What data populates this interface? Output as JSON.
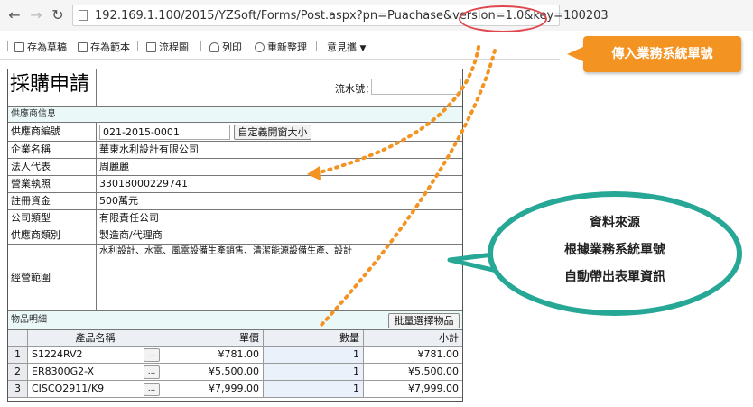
{
  "browser": {
    "back_icon": "arrow-left",
    "forward_icon": "arrow-right",
    "reload_icon": "reload",
    "url": "192.169.1.100/2015/YZSoft/Forms/Post.aspx?pn=Puachase&version=1.0&key=100203"
  },
  "toolbar": {
    "save_draft": "存為草稿",
    "save_template": "存為範本",
    "flowchart": "流程圖",
    "print": "列印",
    "reset": "重新整理",
    "feedback": "意見攜"
  },
  "form": {
    "title": "採購申請",
    "serial_label": "流水號：",
    "supplier_section": "供應商信息",
    "fields": {
      "supplier_no_label": "供應商編號",
      "supplier_no_value": "021-2015-0001",
      "custom_window_button": "自定義開窗大小",
      "company_name_label": "企業名稱",
      "company_name_value": "華東水利設計有限公司",
      "legal_rep_label": "法人代表",
      "legal_rep_value": "周麗麗",
      "license_label": "營業執照",
      "license_value": "33018000229741",
      "capital_label": "註冊資金",
      "capital_value": "500萬元",
      "company_type_label": "公司類型",
      "company_type_value": "有限責任公司",
      "supplier_type_label": "供應商類別",
      "supplier_type_value": "製造商/代理商",
      "scope_label": "經營範圍",
      "scope_value": "水利設計、水電、風電設備生產銷售、清潔能源設備生產、設計"
    },
    "items_section": "物品明細",
    "batch_select_button": "批量選擇物品",
    "item_columns": {
      "product": "產品名稱",
      "price": "單價",
      "qty": "數量",
      "subtotal": "小計"
    },
    "items": [
      {
        "no": "1",
        "name": "S1224RV2",
        "price": "¥781.00",
        "qty": "1",
        "subtotal": "¥781.00"
      },
      {
        "no": "2",
        "name": "ER8300G2-X",
        "price": "¥5,500.00",
        "qty": "1",
        "subtotal": "¥5,500.00"
      },
      {
        "no": "3",
        "name": "CISCO2911/K9",
        "price": "¥7,999.00",
        "qty": "1",
        "subtotal": "¥7,999.00"
      }
    ]
  },
  "annotations": {
    "orange_callout": "傳入業務系統單號",
    "bubble_line1": "資料來源",
    "bubble_line2": "根據業務系統單號",
    "bubble_line3": "自動帶出表單資訊",
    "colors": {
      "orange": "#f39322",
      "teal": "#27a796",
      "red": "#e0474c"
    }
  }
}
